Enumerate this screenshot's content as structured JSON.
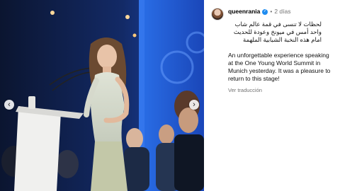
{
  "post": {
    "username": "queenrania",
    "time_ago": "2 días",
    "caption_arabic": "لحظات لا تنسى في قمة عالم شاب واحد أمس في ميونخ وعودة للحديث امام هذه النخبة الشبابية الملهمة",
    "caption_english": "An unforgettable experience speaking at the One Young World Summit in Munich yesterday. It was a pleasure to return to this stage!",
    "translate_label": "Ver traducción"
  },
  "carousel": {
    "prev_symbol": "‹",
    "next_symbol": "›"
  },
  "icons": {
    "verified": "verified-badge-icon",
    "prev": "chevron-left-icon",
    "next": "chevron-right-icon"
  },
  "colors": {
    "verified_blue": "#1f8cf0",
    "muted_text": "#737373",
    "stage_blue": "#1d5fd6"
  }
}
